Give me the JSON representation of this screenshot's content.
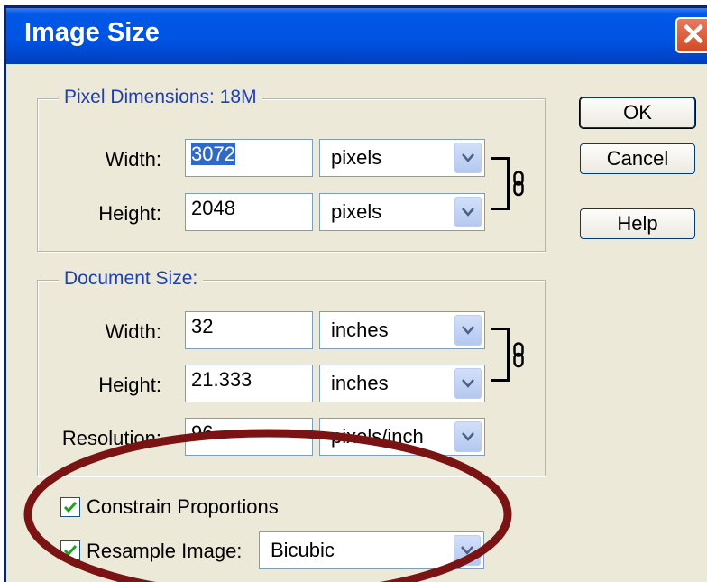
{
  "window": {
    "title": "Image Size",
    "close_glyph": "✕"
  },
  "pixel_dimensions": {
    "legend": "Pixel Dimensions:  18M",
    "width": {
      "label": "Width:",
      "value": "3072",
      "unit": "pixels"
    },
    "height": {
      "label": "Height:",
      "value": "2048",
      "unit": "pixels"
    }
  },
  "document_size": {
    "legend": "Document Size:",
    "width": {
      "label": "Width:",
      "value": "32",
      "unit": "inches"
    },
    "height": {
      "label": "Height:",
      "value": "21.333",
      "unit": "inches"
    },
    "resolution": {
      "label": "Resolution:",
      "value": "96",
      "unit": "pixels/inch"
    }
  },
  "options": {
    "constrain": {
      "label": "Constrain Proportions",
      "checked": true
    },
    "resample": {
      "label": "Resample Image:",
      "checked": true,
      "method": "Bicubic"
    }
  },
  "buttons": {
    "ok": "OK",
    "cancel": "Cancel",
    "help": "Help"
  },
  "colors": {
    "annotation_ring": "#7a1414",
    "legend_text": "#1c3fb4",
    "titlebar": "#0054e3"
  }
}
